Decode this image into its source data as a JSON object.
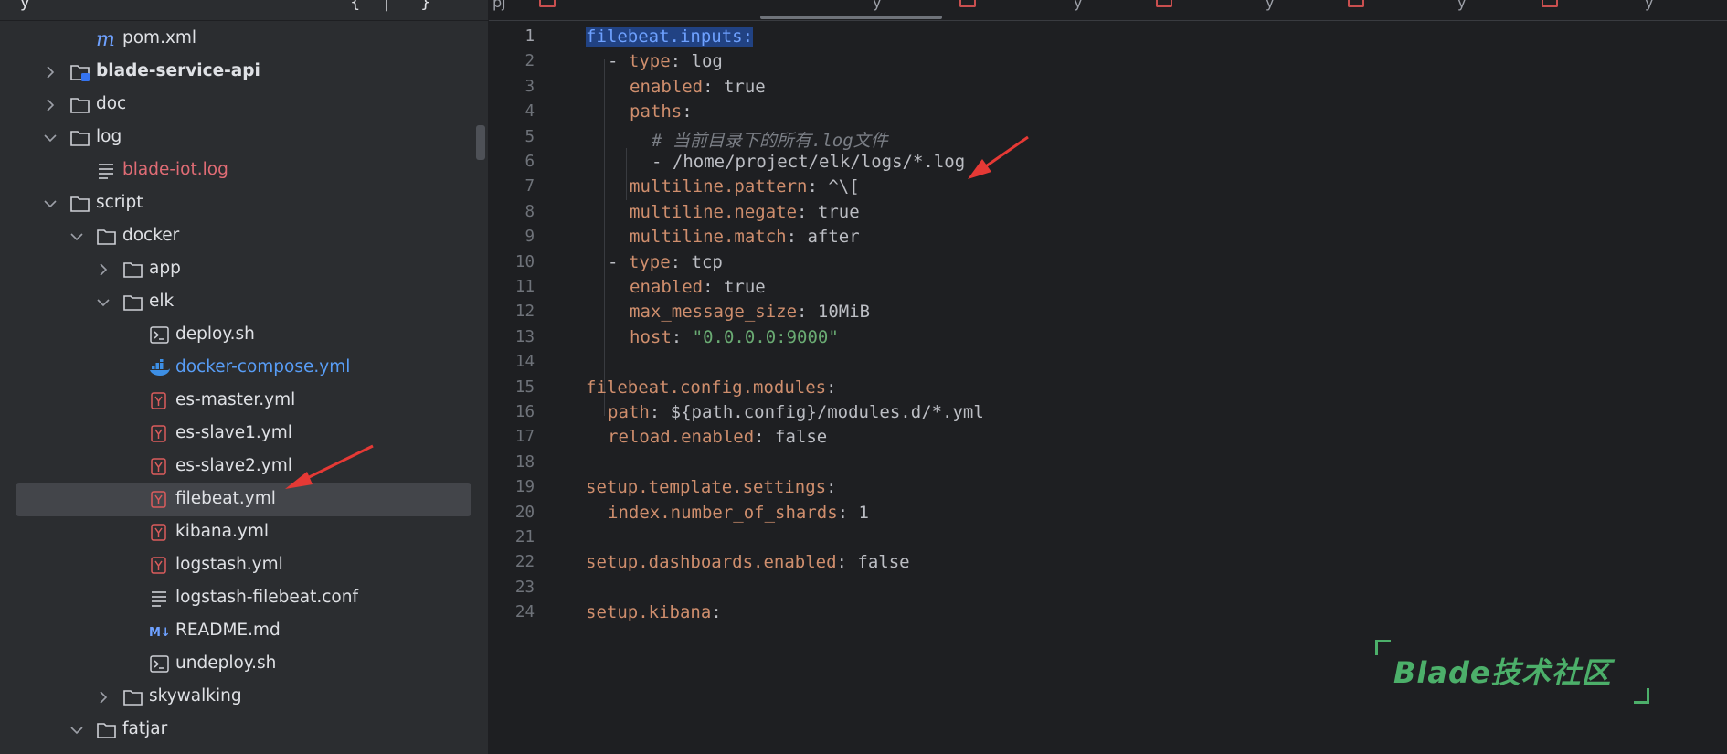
{
  "tree": {
    "top_fragments": [
      "y",
      "{",
      "|",
      "}"
    ],
    "items": [
      {
        "label": "pom.xml",
        "icon": "maven-icon",
        "depth": 3,
        "chevron": "none"
      },
      {
        "label": "blade-service-api",
        "icon": "module-folder-icon",
        "depth": 2,
        "chevron": "collapsed",
        "bold": true
      },
      {
        "label": "doc",
        "icon": "folder-icon",
        "depth": 2,
        "chevron": "collapsed"
      },
      {
        "label": "log",
        "icon": "folder-icon",
        "depth": 2,
        "chevron": "expanded"
      },
      {
        "label": "blade-iot.log",
        "icon": "text-file-icon",
        "depth": 3,
        "chevron": "none",
        "color": "red"
      },
      {
        "label": "script",
        "icon": "folder-icon",
        "depth": 2,
        "chevron": "expanded"
      },
      {
        "label": "docker",
        "icon": "folder-icon",
        "depth": 3,
        "chevron": "expanded"
      },
      {
        "label": "app",
        "icon": "folder-icon",
        "depth": 4,
        "chevron": "collapsed"
      },
      {
        "label": "elk",
        "icon": "folder-icon",
        "depth": 4,
        "chevron": "expanded"
      },
      {
        "label": "deploy.sh",
        "icon": "shell-script-icon",
        "depth": 5,
        "chevron": "none"
      },
      {
        "label": "docker-compose.yml",
        "icon": "docker-icon",
        "depth": 5,
        "chevron": "none",
        "color": "blue"
      },
      {
        "label": "es-master.yml",
        "icon": "yaml-icon",
        "depth": 5,
        "chevron": "none"
      },
      {
        "label": "es-slave1.yml",
        "icon": "yaml-icon",
        "depth": 5,
        "chevron": "none"
      },
      {
        "label": "es-slave2.yml",
        "icon": "yaml-icon",
        "depth": 5,
        "chevron": "none"
      },
      {
        "label": "filebeat.yml",
        "icon": "yaml-icon",
        "depth": 5,
        "chevron": "none",
        "selected": true
      },
      {
        "label": "kibana.yml",
        "icon": "yaml-icon",
        "depth": 5,
        "chevron": "none"
      },
      {
        "label": "logstash.yml",
        "icon": "yaml-icon",
        "depth": 5,
        "chevron": "none"
      },
      {
        "label": "logstash-filebeat.conf",
        "icon": "text-file-icon",
        "depth": 5,
        "chevron": "none"
      },
      {
        "label": "README.md",
        "icon": "markdown-icon",
        "depth": 5,
        "chevron": "none"
      },
      {
        "label": "undeploy.sh",
        "icon": "shell-script-icon",
        "depth": 5,
        "chevron": "none"
      },
      {
        "label": "skywalking",
        "icon": "folder-icon",
        "depth": 4,
        "chevron": "collapsed"
      },
      {
        "label": "fatjar",
        "icon": "folder-icon",
        "depth": 3,
        "chevron": "expanded"
      }
    ]
  },
  "editor": {
    "tab_fragments": [
      "pj",
      "y",
      "y",
      "y",
      "y",
      "y"
    ],
    "current_line": 1,
    "lines": [
      {
        "n": "1",
        "indent": 0,
        "tokens": [
          {
            "t": "filebeat.inputs:",
            "k": "hlkey"
          }
        ]
      },
      {
        "n": "2",
        "indent": 1,
        "tokens": [
          {
            "t": "- ",
            "k": "p"
          },
          {
            "t": "type",
            "k": "key"
          },
          {
            "t": ": log",
            "k": "p"
          }
        ]
      },
      {
        "n": "3",
        "indent": 2,
        "tokens": [
          {
            "t": "enabled",
            "k": "key"
          },
          {
            "t": ": true",
            "k": "p"
          }
        ]
      },
      {
        "n": "4",
        "indent": 2,
        "tokens": [
          {
            "t": "paths",
            "k": "key"
          },
          {
            "t": ":",
            "k": "p"
          }
        ]
      },
      {
        "n": "5",
        "indent": 3,
        "tokens": [
          {
            "t": "# 当前目录下的所有.log文件",
            "k": "comment"
          }
        ]
      },
      {
        "n": "6",
        "indent": 3,
        "tokens": [
          {
            "t": "- /home/project/elk/logs/*.log",
            "k": "p"
          }
        ]
      },
      {
        "n": "7",
        "indent": 2,
        "tokens": [
          {
            "t": "multiline.pattern",
            "k": "key"
          },
          {
            "t": ": ^\\[",
            "k": "p"
          }
        ]
      },
      {
        "n": "8",
        "indent": 2,
        "tokens": [
          {
            "t": "multiline.negate",
            "k": "key"
          },
          {
            "t": ": true",
            "k": "p"
          }
        ]
      },
      {
        "n": "9",
        "indent": 2,
        "tokens": [
          {
            "t": "multiline.match",
            "k": "key"
          },
          {
            "t": ": after",
            "k": "p"
          }
        ]
      },
      {
        "n": "10",
        "indent": 1,
        "tokens": [
          {
            "t": "- ",
            "k": "p"
          },
          {
            "t": "type",
            "k": "key"
          },
          {
            "t": ": tcp",
            "k": "p"
          }
        ]
      },
      {
        "n": "11",
        "indent": 2,
        "tokens": [
          {
            "t": "enabled",
            "k": "key"
          },
          {
            "t": ": true",
            "k": "p"
          }
        ]
      },
      {
        "n": "12",
        "indent": 2,
        "tokens": [
          {
            "t": "max_message_size",
            "k": "key"
          },
          {
            "t": ": 10MiB",
            "k": "p"
          }
        ]
      },
      {
        "n": "13",
        "indent": 2,
        "tokens": [
          {
            "t": "host",
            "k": "key"
          },
          {
            "t": ": ",
            "k": "p"
          },
          {
            "t": "\"0.0.0.0:9000\"",
            "k": "str"
          }
        ]
      },
      {
        "n": "14",
        "indent": 0,
        "tokens": []
      },
      {
        "n": "15",
        "indent": 0,
        "tokens": [
          {
            "t": "filebeat.config.modules",
            "k": "key"
          },
          {
            "t": ":",
            "k": "p"
          }
        ]
      },
      {
        "n": "16",
        "indent": 1,
        "tokens": [
          {
            "t": "path",
            "k": "key"
          },
          {
            "t": ": ${path.config}/modules.d/*.yml",
            "k": "p"
          }
        ]
      },
      {
        "n": "17",
        "indent": 1,
        "tokens": [
          {
            "t": "reload.enabled",
            "k": "key"
          },
          {
            "t": ": false",
            "k": "p"
          }
        ]
      },
      {
        "n": "18",
        "indent": 0,
        "tokens": []
      },
      {
        "n": "19",
        "indent": 0,
        "tokens": [
          {
            "t": "setup.template.settings",
            "k": "key"
          },
          {
            "t": ":",
            "k": "p"
          }
        ]
      },
      {
        "n": "20",
        "indent": 1,
        "tokens": [
          {
            "t": "index.number_of_shards",
            "k": "key"
          },
          {
            "t": ": 1",
            "k": "p"
          }
        ]
      },
      {
        "n": "21",
        "indent": 0,
        "tokens": []
      },
      {
        "n": "22",
        "indent": 0,
        "tokens": [
          {
            "t": "setup.dashboards.enabled",
            "k": "key"
          },
          {
            "t": ": false",
            "k": "p"
          }
        ]
      },
      {
        "n": "23",
        "indent": 0,
        "tokens": []
      },
      {
        "n": "24",
        "indent": 0,
        "tokens": [
          {
            "t": "setup.kibana",
            "k": "key"
          },
          {
            "t": ":",
            "k": "p"
          }
        ]
      }
    ]
  },
  "watermark": {
    "text": "Blade技术社区"
  },
  "colors": {
    "keyword": "#cf8e6d",
    "string": "#6aab73",
    "comment": "#7a7e85",
    "highlight": "#214283",
    "watermark": "#4caf6a",
    "arrow": "#e53935"
  }
}
